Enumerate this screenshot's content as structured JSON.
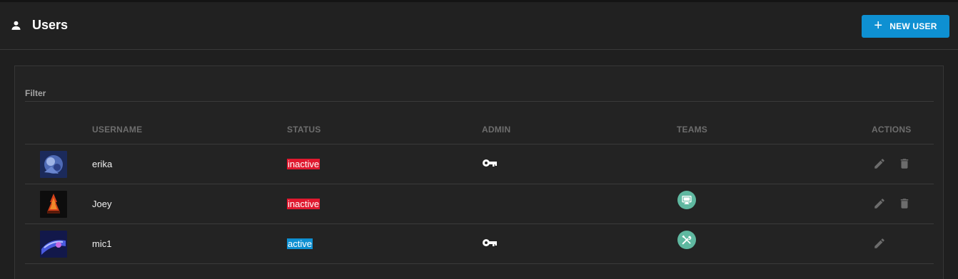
{
  "header": {
    "title": "Users",
    "user_icon": "person-icon",
    "new_user_button": {
      "label": "NEW USER",
      "icon": "plus-icon",
      "color": "#0e90d2"
    }
  },
  "filter": {
    "label": "Filter"
  },
  "table": {
    "columns": [
      "USERNAME",
      "STATUS",
      "ADMIN",
      "TEAMS",
      "ACTIONS"
    ],
    "rows": [
      {
        "username": "erika",
        "status": "inactive",
        "status_color": "#e0192f",
        "admin": true,
        "team_icon": "",
        "actions": [
          "edit",
          "delete"
        ]
      },
      {
        "username": "Joey",
        "status": "inactive",
        "status_color": "#e0192f",
        "admin": false,
        "team_icon": "monitor-icon",
        "actions": [
          "edit",
          "delete"
        ]
      },
      {
        "username": "mic1",
        "status": "active",
        "status_color": "#0e90d2",
        "admin": true,
        "team_icon": "wrench-screwdriver-icon",
        "actions": [
          "edit"
        ]
      }
    ]
  },
  "colors": {
    "accent": "#0e90d2",
    "inactive": "#e0192f",
    "team_badge": "#5fb8a0",
    "action_icon": "#6c6c6c"
  }
}
